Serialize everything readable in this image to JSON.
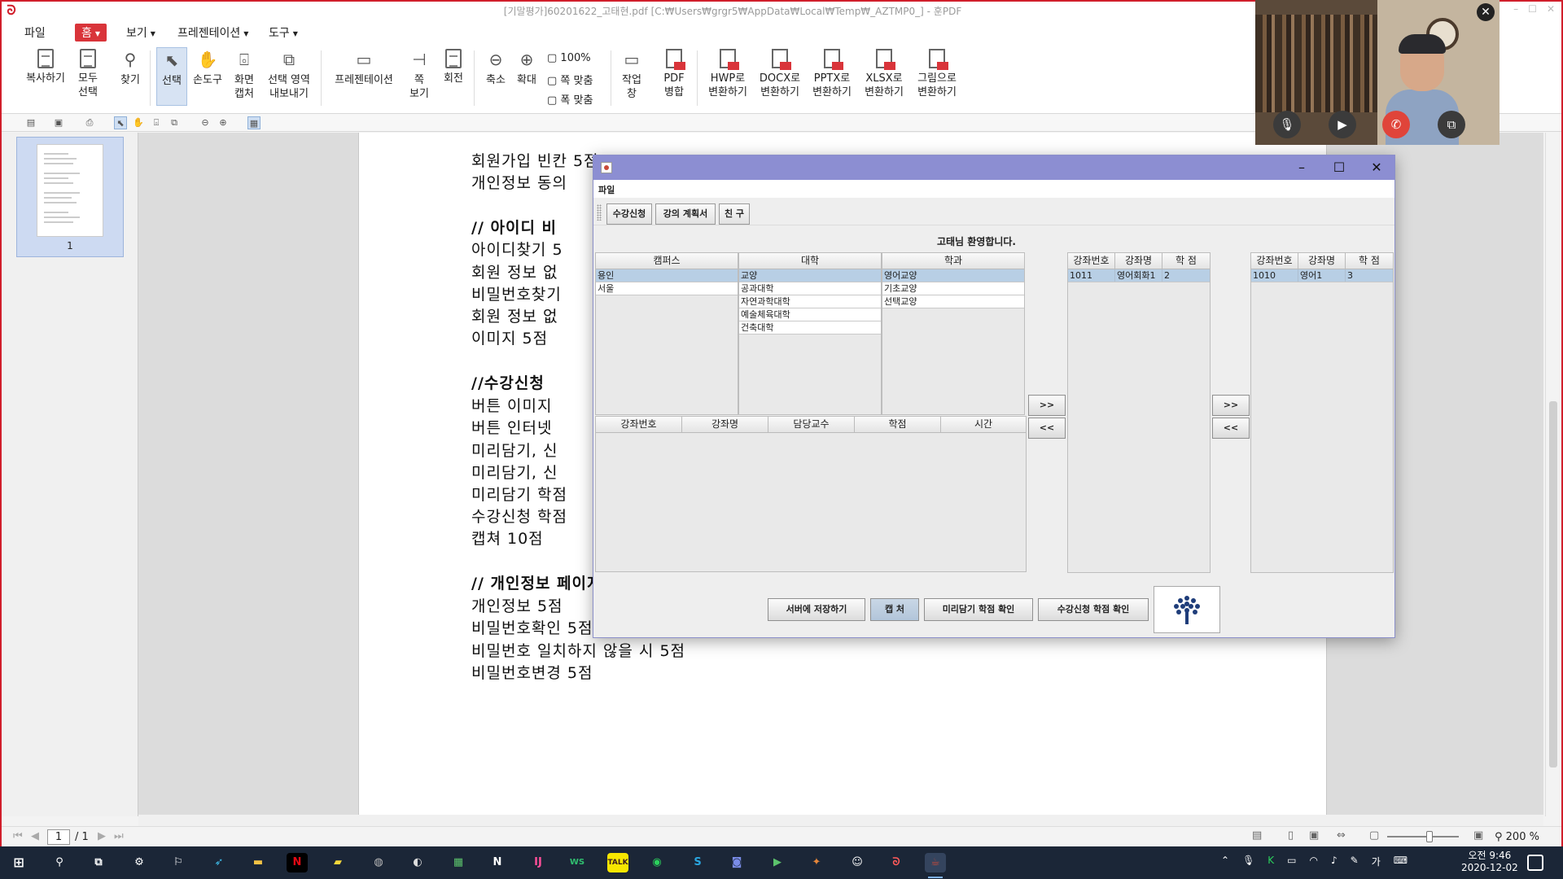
{
  "window": {
    "title": "[기말평가]60201622_고태현.pdf [C:₩Users₩grgr5₩AppData₩Local₩Temp₩_AZTMP0_] - 훈PDF",
    "controls": [
      "–",
      "☐",
      "✕"
    ]
  },
  "menubar": [
    "파일",
    "홈",
    "보기",
    "프레젠테이션",
    "도구"
  ],
  "ribbon": {
    "copy": "복사하기",
    "select_all_1": "모두",
    "select_all_2": "선택",
    "find": "찾기",
    "select": "선택",
    "hand": "손도구",
    "capture_1": "화면",
    "capture_2": "캡처",
    "export_1": "선택 영역",
    "export_2": "내보내기",
    "presentation": "프레젠테이션",
    "page_view_1": "쪽",
    "page_view_2": "보기",
    "rotate": "회전",
    "zoom_out": "축소",
    "zoom_in": "확대",
    "zoom_100": "100%",
    "fit_page": "쪽 맞춤",
    "fit_width": "폭 맞춤",
    "work_win_1": "작업",
    "work_win_2": "창",
    "pdf_merge_1": "PDF",
    "pdf_merge_2": "병합",
    "to_hwp_1": "HWP로",
    "to_docx_1": "DOCX로",
    "to_pptx_1": "PPTX로",
    "to_xlsx_1": "XLSX로",
    "to_img_1": "그림으로",
    "convert": "변환하기"
  },
  "thumbnail": {
    "page_label": "1"
  },
  "document_lines": [
    {
      "text": "회원가입 빈칸 5점",
      "head": false
    },
    {
      "text": "개인정보 동의",
      "head": false
    },
    {
      "text": "// 아이디 비",
      "head": true
    },
    {
      "text": "아이디찾기 5",
      "head": false
    },
    {
      "text": "회원 정보 없",
      "head": false
    },
    {
      "text": "비밀번호찾기",
      "head": false
    },
    {
      "text": "회원 정보 없",
      "head": false
    },
    {
      "text": "이미지 5점",
      "head": false
    },
    {
      "text": "//수강신청",
      "head": true
    },
    {
      "text": "버튼 이미지",
      "head": false
    },
    {
      "text": "버튼 인터넷",
      "head": false
    },
    {
      "text": "미리담기, 신",
      "head": false
    },
    {
      "text": "미리담기, 신",
      "head": false
    },
    {
      "text": "미리담기 학점",
      "head": false
    },
    {
      "text": "수강신청 학점",
      "head": false
    },
    {
      "text": "캡쳐 10점",
      "head": false
    },
    {
      "text": "// 개인정보 페이지",
      "head": true
    },
    {
      "text": "개인정보 5점",
      "head": false
    },
    {
      "text": "비밀번호확인 5점",
      "head": false
    },
    {
      "text": "비밀번호 일치하지 않을 시 5점",
      "head": false
    },
    {
      "text": "비밀번호변경 5점",
      "head": false
    }
  ],
  "statusbar": {
    "page_current": "1",
    "page_total": "/ 1",
    "zoom": "200 %"
  },
  "app": {
    "menu": "파일",
    "tabs": [
      "수강신청",
      "강의 계획서",
      "친 구"
    ],
    "welcome": "고태님 환영합니다.",
    "campus": {
      "header": "캠퍼스",
      "items": [
        "용인",
        "서울"
      ],
      "selected": 0
    },
    "college": {
      "header": "대학",
      "items": [
        "교양",
        "공과대학",
        "자연과학대학",
        "예술체육대학",
        "건축대학"
      ],
      "selected": 0
    },
    "dept": {
      "header": "학과",
      "items": [
        "영어교양",
        "기초교양",
        "선택교양"
      ],
      "selected": 0
    },
    "course_table": {
      "headers": [
        "강좌번호",
        "강좌명",
        "담당교수",
        "학점",
        "시간"
      ]
    },
    "preload_table": {
      "headers": [
        "강좌번호",
        "강좌명",
        "학 점"
      ],
      "rows": [
        [
          "1011",
          "영어회화1",
          "2"
        ]
      ]
    },
    "enroll_table": {
      "headers": [
        "강좌번호",
        "강좌명",
        "학 점"
      ],
      "rows": [
        [
          "1010",
          "영어1",
          "3"
        ]
      ]
    },
    "move_right": ">>",
    "move_left": "<<",
    "buttons": {
      "save_server": "서버에 저장하기",
      "capture": "캡 처",
      "preload_credit": "미리담기 학점 확인",
      "enroll_credit": "수강신청 학점 확인"
    }
  },
  "video": {
    "close": "✕"
  },
  "taskbar": {
    "clock_time": "오전 9:46",
    "clock_date": "2020-12-02",
    "ime": "가"
  }
}
